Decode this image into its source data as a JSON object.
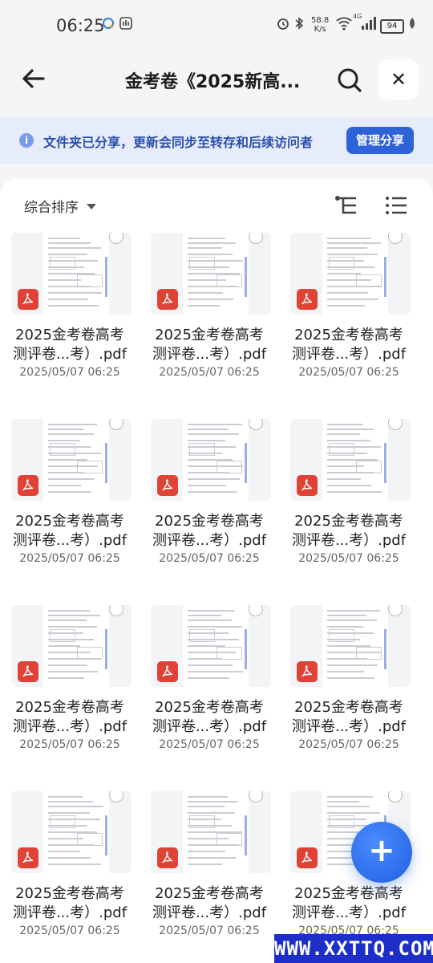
{
  "status_bar": {
    "time": "06:25",
    "net_speed_value": "58.8",
    "net_speed_unit": "K/s",
    "network": "4G",
    "battery": "94",
    "icons": [
      "browser-icon",
      "hand-icon",
      "alarm-icon",
      "bluetooth-icon",
      "wifi-icon",
      "signal-icon",
      "leaf-icon"
    ]
  },
  "header": {
    "title": "金考卷《2025新高...",
    "icons": [
      "back-arrow-icon",
      "search-icon",
      "close-icon"
    ],
    "close_symbol": "✕"
  },
  "banner": {
    "info_symbol": "i",
    "text": "文件夹已分享，更新会同步至转存和后续访问者",
    "manage_label": "管理分享"
  },
  "toolbar": {
    "sort_label": "综合排序",
    "icons": [
      "caret-down-icon",
      "tree-view-icon",
      "list-view-icon"
    ]
  },
  "files": [
    {
      "name_line1": "2025金考卷高考",
      "name_line2": "测评卷...考）.pdf",
      "date": "2025/05/07 06:25"
    },
    {
      "name_line1": "2025金考卷高考",
      "name_line2": "测评卷...考）.pdf",
      "date": "2025/05/07 06:25"
    },
    {
      "name_line1": "2025金考卷高考",
      "name_line2": "测评卷...考）.pdf",
      "date": "2025/05/07 06:25"
    },
    {
      "name_line1": "2025金考卷高考",
      "name_line2": "测评卷...考）.pdf",
      "date": "2025/05/07 06:25"
    },
    {
      "name_line1": "2025金考卷高考",
      "name_line2": "测评卷...考）.pdf",
      "date": "2025/05/07 06:25"
    },
    {
      "name_line1": "2025金考卷高考",
      "name_line2": "测评卷...考）.pdf",
      "date": "2025/05/07 06:25"
    },
    {
      "name_line1": "2025金考卷高考",
      "name_line2": "测评卷...考）.pdf",
      "date": "2025/05/07 06:25"
    },
    {
      "name_line1": "2025金考卷高考",
      "name_line2": "测评卷...考）.pdf",
      "date": "2025/05/07 06:25"
    },
    {
      "name_line1": "2025金考卷高考",
      "name_line2": "测评卷...考）.pdf",
      "date": "2025/05/07 06:25"
    },
    {
      "name_line1": "2025金考卷高考",
      "name_line2": "测评卷...考）.pdf",
      "date": "2025/05/07 06:25"
    },
    {
      "name_line1": "2025金考卷高考",
      "name_line2": "测评卷...考）.pdf",
      "date": "2025/05/07 06:25"
    },
    {
      "name_line1": "2025金考卷高考",
      "name_line2": "测评卷...考）.pdf",
      "date": "2025/05/07 06:25"
    }
  ],
  "fab": {
    "symbol": "+"
  },
  "watermark": {
    "text": "WWW.XXTTQ.COM"
  },
  "colors": {
    "accent": "#2f62d6",
    "banner_bg": "#e7ecfa",
    "pdf_red": "#e04336",
    "watermark_bg": "#1e2fc9"
  }
}
